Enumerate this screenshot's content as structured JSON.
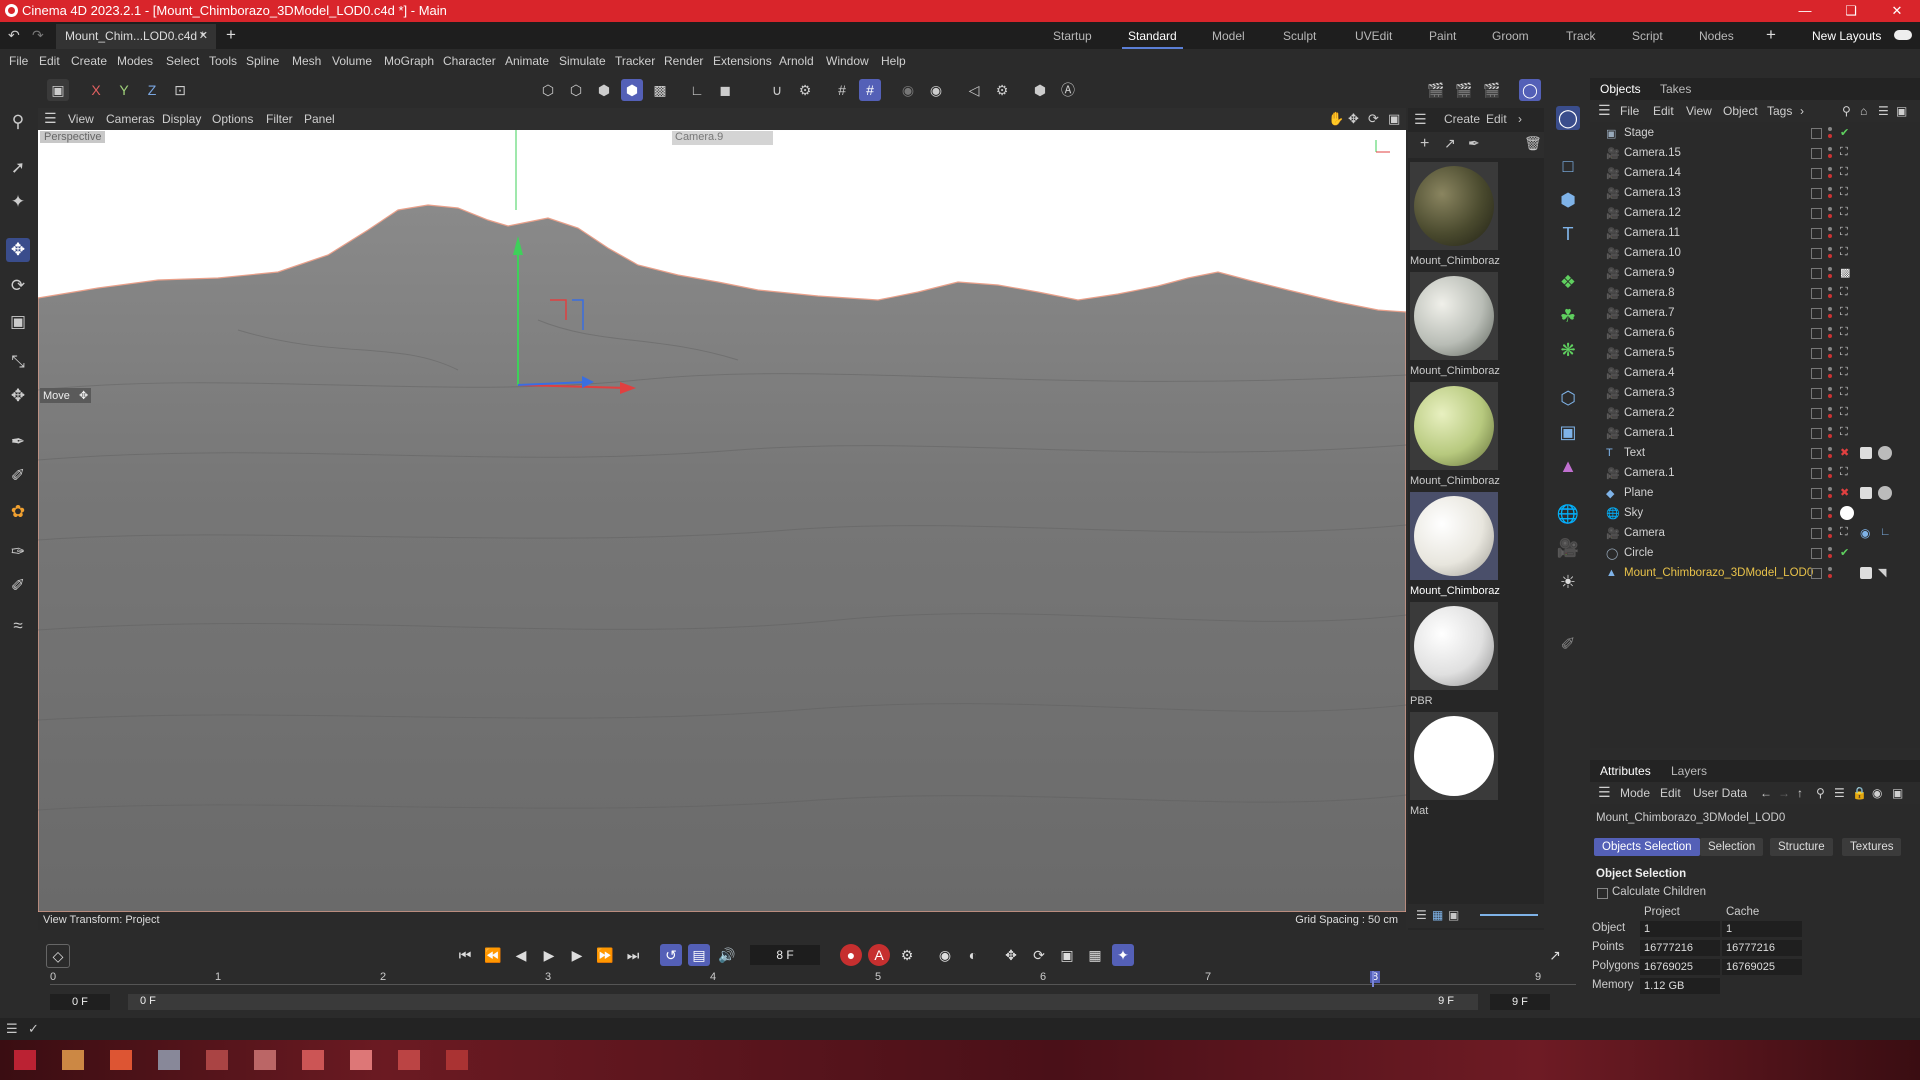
{
  "window": {
    "title": "Cinema 4D 2023.2.1 - [Mount_Chimborazo_3DModel_LOD0.c4d *] - Main"
  },
  "doc_tab": {
    "label": "Mount_Chim...LOD0.c4d *"
  },
  "layouts": {
    "tabs": [
      "Startup",
      "Standard",
      "Model",
      "Sculpt",
      "UVEdit",
      "Paint",
      "Groom",
      "Track",
      "Script",
      "Nodes"
    ],
    "active": "Standard",
    "new_layouts": "New Layouts"
  },
  "menu": [
    "File",
    "Edit",
    "Create",
    "Modes",
    "Select",
    "Tools",
    "Spline",
    "Mesh",
    "Volume",
    "MoGraph",
    "Character",
    "Animate",
    "Simulate",
    "Tracker",
    "Render",
    "Extensions",
    "Arnold",
    "Window",
    "Help"
  ],
  "axes": {
    "x": "X",
    "y": "Y",
    "z": "Z"
  },
  "viewport": {
    "menu": [
      "View",
      "Cameras",
      "Display",
      "Options",
      "Filter",
      "Panel"
    ],
    "name": "Perspective",
    "camera": "Camera.9",
    "tool_label": "Move",
    "view_transform": "View Transform: Project",
    "grid_spacing": "Grid Spacing : 50 cm"
  },
  "materials": {
    "menu": [
      "Create",
      "Edit"
    ],
    "items": [
      {
        "label": "Mount_Chimboraz",
        "color": "#4a4a2e"
      },
      {
        "label": "Mount_Chimboraz",
        "color": "#b9bdb6"
      },
      {
        "label": "Mount_Chimboraz",
        "color": "#b7c97e"
      },
      {
        "label": "Mount_Chimboraz",
        "color": "#e8e6de"
      },
      {
        "label": "PBR",
        "color": "#f0f0f0"
      },
      {
        "label": "Mat",
        "color": "#ffffff"
      }
    ]
  },
  "object_manager": {
    "tabs": [
      "Objects",
      "Takes"
    ],
    "menu": [
      "File",
      "Edit",
      "View",
      "Object",
      "Tags"
    ],
    "objects": [
      "Stage",
      "Camera.15",
      "Camera.14",
      "Camera.13",
      "Camera.12",
      "Camera.11",
      "Camera.10",
      "Camera.9",
      "Camera.8",
      "Camera.7",
      "Camera.6",
      "Camera.5",
      "Camera.4",
      "Camera.3",
      "Camera.2",
      "Camera.1",
      "Text",
      "Camera.1",
      "Plane",
      "Sky",
      "Camera",
      "Circle",
      "Mount_Chimborazo_3DModel_LOD0"
    ],
    "selected_color": "#e8c24a"
  },
  "attributes": {
    "tabs": [
      "Attributes",
      "Layers"
    ],
    "menu": [
      "Mode",
      "Edit",
      "User Data"
    ],
    "object_name": "Mount_Chimborazo_3DModel_LOD0",
    "buttons": [
      "Objects Selection",
      "Selection",
      "Structure",
      "Textures"
    ],
    "section": "Object Selection",
    "calc_children": "Calculate Children",
    "col_project": "Project",
    "col_cache": "Cache",
    "rows": [
      {
        "label": "Object",
        "project": "1",
        "cache": "1"
      },
      {
        "label": "Points",
        "project": "16777216",
        "cache": "16777216"
      },
      {
        "label": "Polygons",
        "project": "16769025",
        "cache": "16769025"
      },
      {
        "label": "Memory",
        "project": "1.12 GB",
        "cache": ""
      }
    ]
  },
  "timeline": {
    "current_frame": "8 F",
    "ticks": [
      "0",
      "1",
      "2",
      "3",
      "4",
      "5",
      "6",
      "7",
      "8",
      "9"
    ],
    "start": "0 F",
    "start2": "0 F",
    "end": "9 F",
    "end2": "9 F"
  }
}
